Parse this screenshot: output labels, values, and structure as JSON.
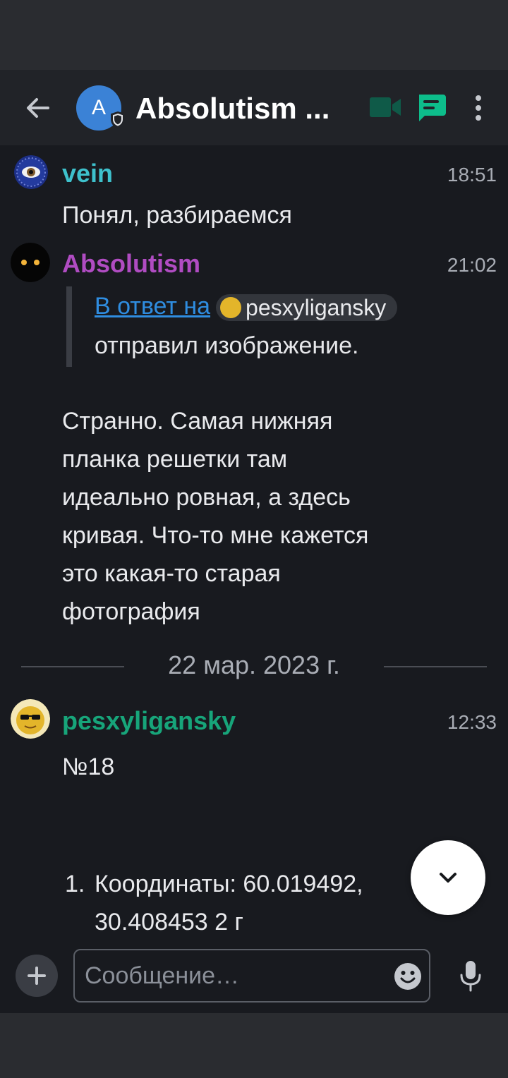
{
  "header": {
    "room_initial": "A",
    "room_title": "Absolutism ..."
  },
  "messages": [
    {
      "sender": "vein",
      "sender_color": "#3ec1cc",
      "time": "18:51",
      "text": "Понял, разбираемся"
    },
    {
      "sender": "Absolutism",
      "sender_color": "#b04cc2",
      "time": "21:02",
      "reply_prefix": "В ответ на",
      "reply_user": "pesxyligansky",
      "reply_text": "отправил изображение.",
      "lines": [
        "Странно. Самая нижняя",
        "планка решетки там",
        "идеально ровная, а здесь",
        "кривая. Что-то мне кажется",
        "это какая-то старая",
        "фотография"
      ]
    },
    {
      "sender": "pesxyligansky",
      "sender_color": "#17a57a",
      "time": "12:33",
      "text": "№18",
      "list_items": [
        {
          "number": "1.",
          "lines": [
            "Координаты: 60.019492,",
            "30.408453 2 г"
          ]
        }
      ]
    }
  ],
  "date_separator": "22 мар. 2023 г.",
  "composer": {
    "placeholder": "Сообщение…"
  },
  "colors": {
    "accent": "#0dbd8b",
    "link": "#2f8de0",
    "background": "#181a1f"
  }
}
